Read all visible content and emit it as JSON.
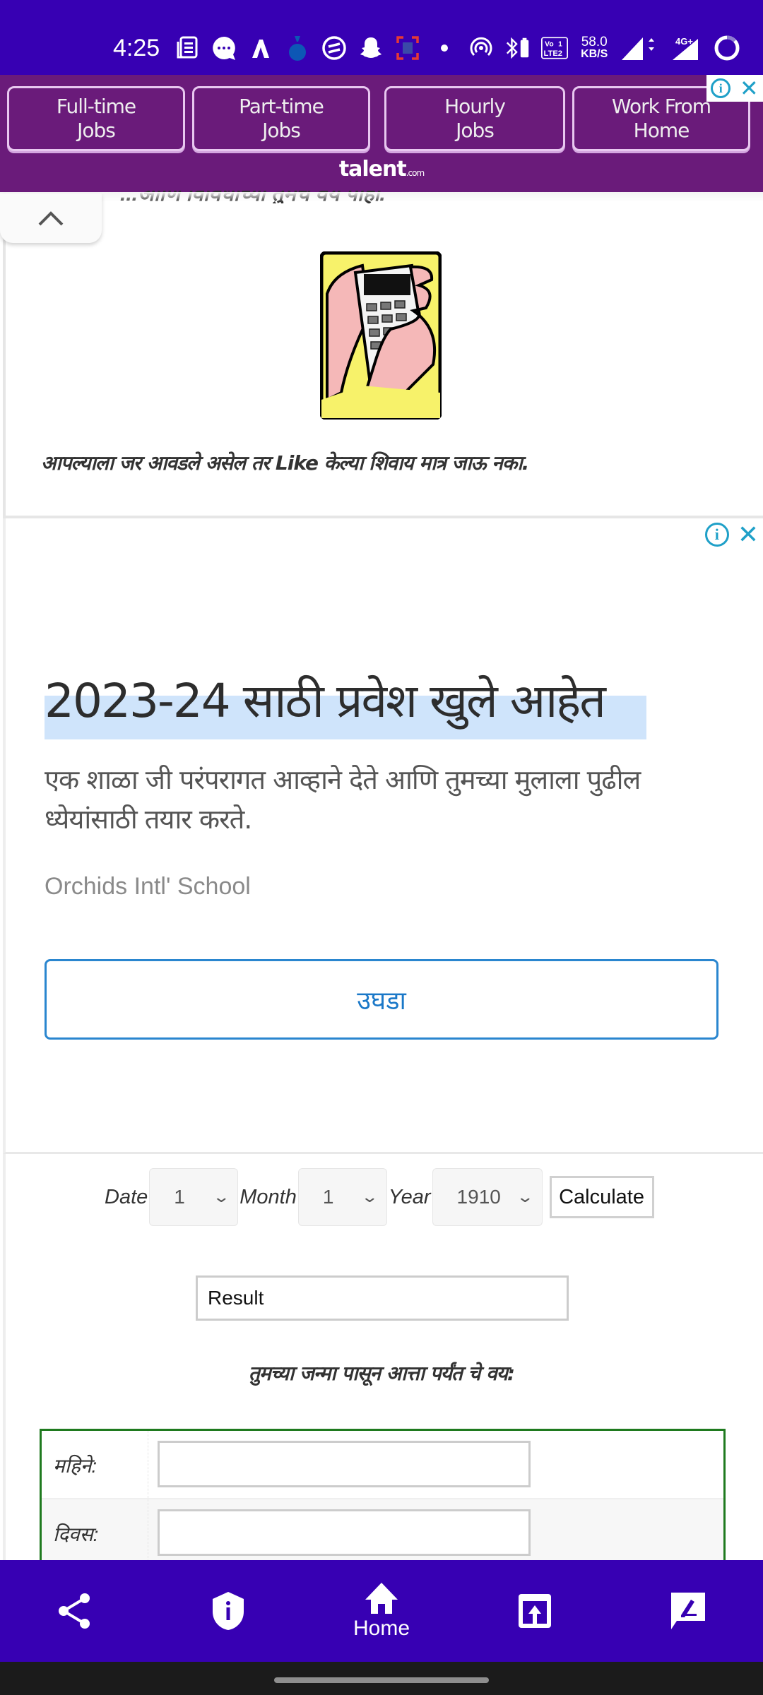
{
  "status_bar": {
    "time": "4:25",
    "network_speed_value": "58.0",
    "network_speed_unit": "KB/S",
    "volte_label": "Vo LTE",
    "signal_label": "4G+",
    "icons": [
      "news-icon",
      "chat-icon",
      "a-logo-icon",
      "money-bag-icon",
      "circle-equals-icon",
      "snapchat-icon",
      "capture-icon",
      "dot-icon",
      "hotspot-icon",
      "bluetooth-battery-icon",
      "volte-icon",
      "speed-icon",
      "signal-icon",
      "signal-4g-icon",
      "battery-ring-icon"
    ]
  },
  "ad_top": {
    "buttons": [
      {
        "label": "Full-time\nJobs"
      },
      {
        "label": "Part-time\nJobs"
      },
      {
        "label": "Hourly\nJobs"
      },
      {
        "label": "Work From\nHome"
      }
    ],
    "logo": "talent",
    "logo_suffix": ".com",
    "ad_info": "i",
    "ad_close": "✕"
  },
  "content": {
    "cut_off_text": "...आणि विविधांच्या तुमचे वय पाहा.",
    "image_alt": "calculator-in-hands",
    "like_text": "आपल्याला जर आवडले असेल तर Like केल्या शिवाय मात्र जाऊ नका."
  },
  "ad_block": {
    "headline": "2023-24 साठी प्रवेश खुले आहेत",
    "description": "एक शाळा जी परंपरागत आव्हाने देते आणि तुमच्या मुलाला पुढील ध्येयांसाठी तयार करते.",
    "source": "Orchids Intl' School",
    "open_button": "उघडा",
    "ad_info": "i",
    "ad_close": "✕"
  },
  "calculator": {
    "date_label": "Date",
    "date_value": "1",
    "month_label": "Month",
    "month_value": "1",
    "year_label": "Year",
    "year_value": "1910",
    "calculate_button": "Calculate",
    "result_value": "Result",
    "age_heading": "तुमच्या जन्मा पासून आत्ता पर्यंत चे वय:",
    "rows": [
      {
        "label": "महिने:",
        "value": ""
      },
      {
        "label": "दिवस:",
        "value": ""
      }
    ]
  },
  "bottom_nav": {
    "items": [
      {
        "name": "share",
        "label": ""
      },
      {
        "name": "privacy",
        "label": ""
      },
      {
        "name": "home",
        "label": "Home"
      },
      {
        "name": "open-external",
        "label": ""
      },
      {
        "name": "feedback",
        "label": ""
      }
    ]
  },
  "colors": {
    "status_bar": "#3700b3",
    "ad_top_bg": "#6a1b7a",
    "ad_choices": "#1fa0c8",
    "open_button": "#2a86cf",
    "table_border": "#1f7a1f",
    "headline_highlight": "#cfe4fb"
  }
}
